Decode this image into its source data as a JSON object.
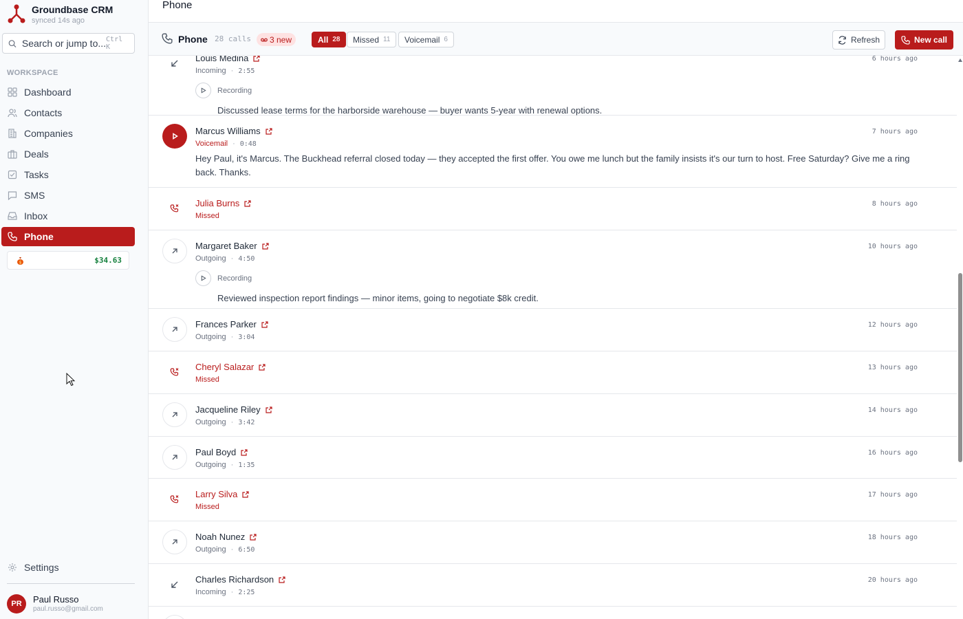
{
  "app": {
    "name": "Groundbase CRM",
    "sync_status": "synced 14s ago"
  },
  "search": {
    "placeholder": "Search or jump to...",
    "shortcut": "Ctrl K"
  },
  "sidebar": {
    "section_label": "WORKSPACE",
    "items": [
      {
        "label": "Dashboard",
        "icon": "dashboard-icon"
      },
      {
        "label": "Contacts",
        "icon": "contacts-icon"
      },
      {
        "label": "Companies",
        "icon": "companies-icon"
      },
      {
        "label": "Deals",
        "icon": "deals-icon"
      },
      {
        "label": "Tasks",
        "icon": "tasks-icon"
      },
      {
        "label": "SMS",
        "icon": "sms-icon"
      },
      {
        "label": "Inbox",
        "icon": "inbox-icon"
      },
      {
        "label": "Phone",
        "icon": "phone-icon",
        "active": true
      }
    ],
    "wallet": {
      "icon": "money-bag-icon",
      "amount": "$34.63"
    },
    "settings_label": "Settings"
  },
  "user": {
    "initials": "PR",
    "name": "Paul Russo",
    "email": "paul.russo@gmail.com"
  },
  "page": {
    "title": "Phone"
  },
  "toolbar": {
    "title": "Phone",
    "count": "28 calls",
    "new_badge": "3 new",
    "filters": [
      {
        "label": "All",
        "count": "28",
        "active": true
      },
      {
        "label": "Missed",
        "count": "11"
      },
      {
        "label": "Voicemail",
        "count": "6"
      }
    ],
    "refresh_label": "Refresh",
    "new_call_label": "New call"
  },
  "calls": [
    {
      "name": "Louis Medina",
      "type": "Incoming",
      "duration": "2:55",
      "time": "6 hours ago",
      "recording_label": "Recording",
      "summary": "Discussed lease terms for the harborside warehouse — buyer wants 5-year with renewal options."
    },
    {
      "name": "Marcus Williams",
      "type": "Voicemail",
      "duration": "0:48",
      "time": "7 hours ago",
      "transcript": "Hey Paul, it's Marcus. The Buckhead referral closed today — they accepted the first offer. You owe me lunch but the family insists it's our turn to host. Free Saturday? Give me a ring back. Thanks."
    },
    {
      "name": "Julia Burns",
      "type": "Missed",
      "time": "8 hours ago"
    },
    {
      "name": "Margaret Baker",
      "type": "Outgoing",
      "duration": "4:50",
      "time": "10 hours ago",
      "recording_label": "Recording",
      "summary": "Reviewed inspection report findings — minor items, going to negotiate $8k credit."
    },
    {
      "name": "Frances Parker",
      "type": "Outgoing",
      "duration": "3:04",
      "time": "12 hours ago"
    },
    {
      "name": "Cheryl Salazar",
      "type": "Missed",
      "time": "13 hours ago"
    },
    {
      "name": "Jacqueline Riley",
      "type": "Outgoing",
      "duration": "3:42",
      "time": "14 hours ago"
    },
    {
      "name": "Paul Boyd",
      "type": "Outgoing",
      "duration": "1:35",
      "time": "16 hours ago"
    },
    {
      "name": "Larry Silva",
      "type": "Missed",
      "time": "17 hours ago"
    },
    {
      "name": "Noah Nunez",
      "type": "Outgoing",
      "duration": "6:50",
      "time": "18 hours ago"
    },
    {
      "name": "Charles Richardson",
      "type": "Incoming",
      "duration": "2:25",
      "time": "20 hours ago"
    }
  ],
  "colors": {
    "brand": "#b91c1c",
    "missed": "#b91c1c",
    "wallet_amount": "#15803d"
  }
}
